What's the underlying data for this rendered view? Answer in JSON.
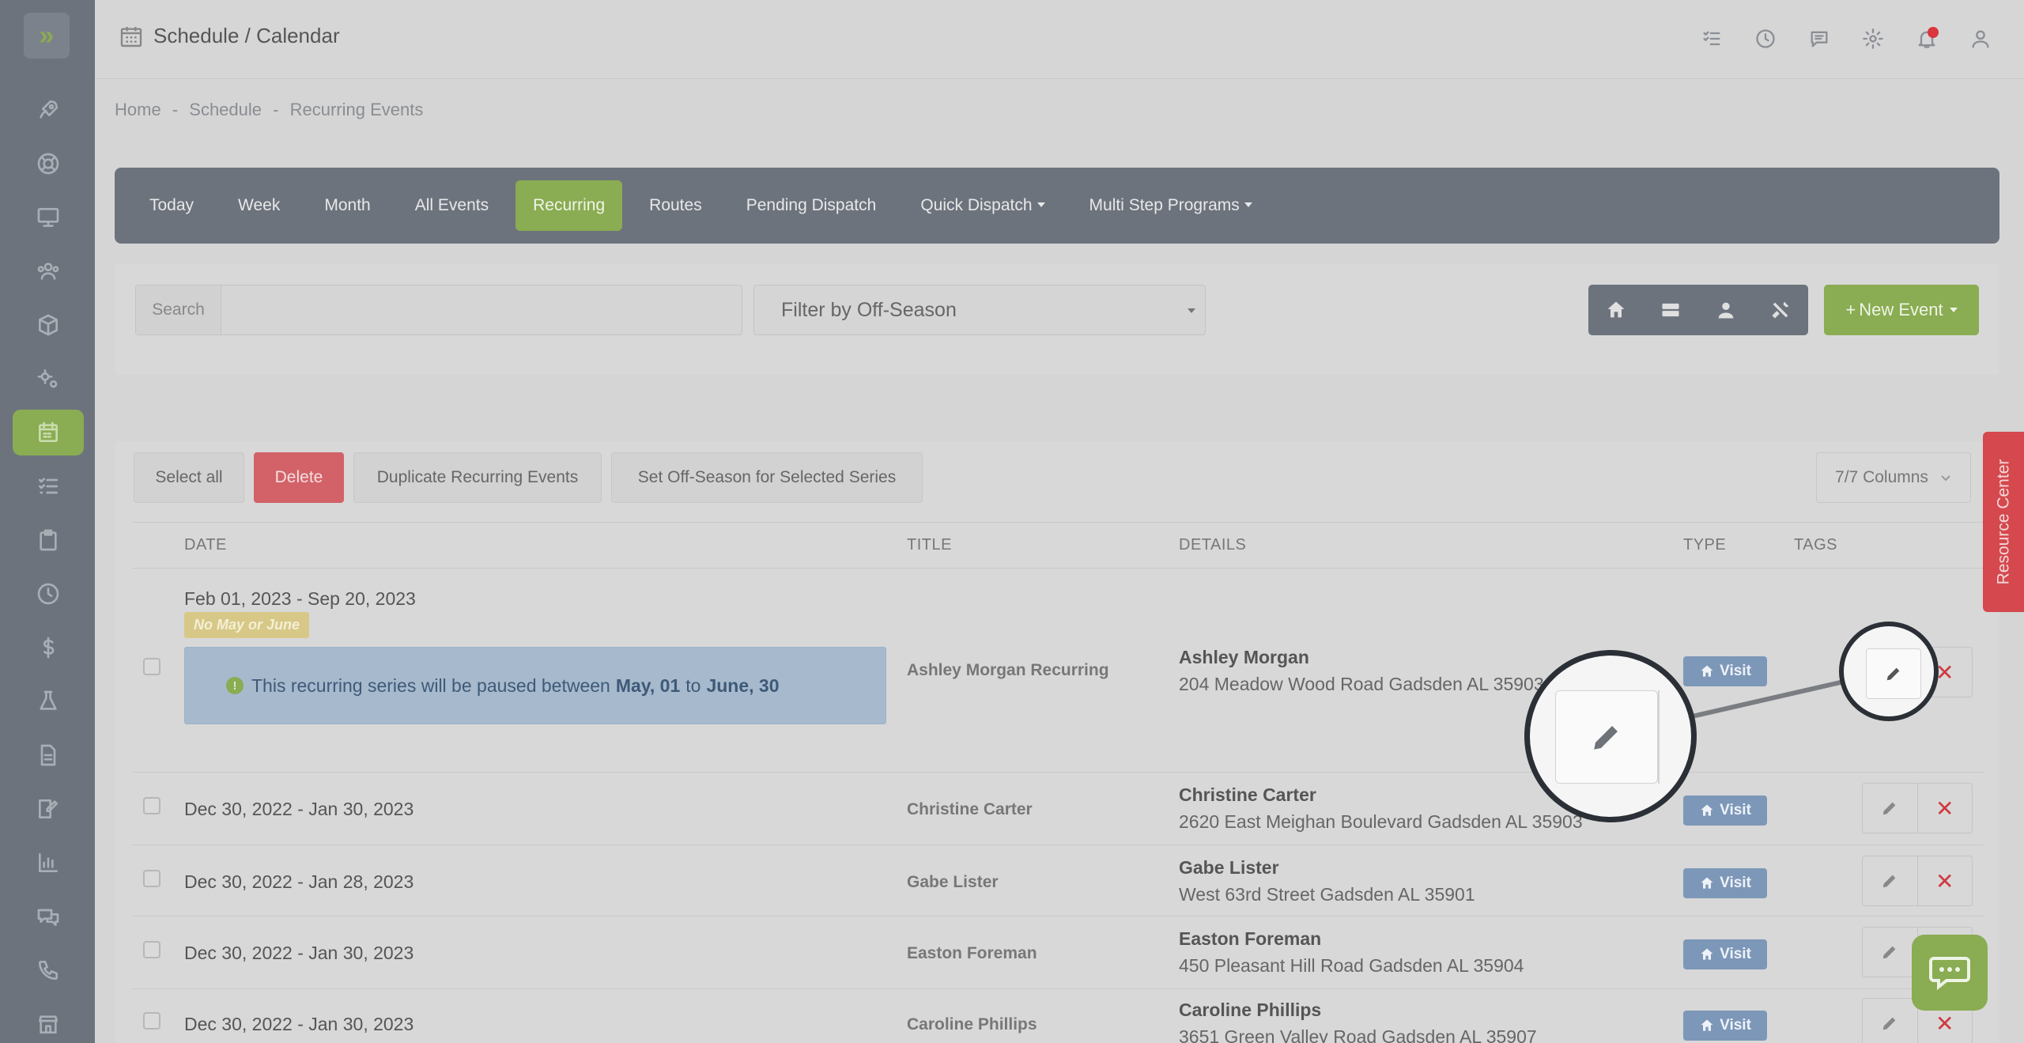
{
  "topbar": {
    "title": "Schedule / Calendar"
  },
  "breadcrumb": {
    "home": "Home",
    "schedule": "Schedule",
    "current": "Recurring Events",
    "sep": "-"
  },
  "tabs": [
    {
      "label": "Today"
    },
    {
      "label": "Week"
    },
    {
      "label": "Month"
    },
    {
      "label": "All Events"
    },
    {
      "label": "Recurring"
    },
    {
      "label": "Routes"
    },
    {
      "label": "Pending Dispatch"
    },
    {
      "label": "Quick Dispatch"
    },
    {
      "label": "Multi Step Programs"
    }
  ],
  "filters": {
    "search_label": "Search",
    "search_value": "",
    "offseason_selected": "Filter by Off-Season",
    "new_event_label": "New Event",
    "new_event_plus": "+"
  },
  "bulk": {
    "select_all": "Select all",
    "delete": "Delete",
    "duplicate": "Duplicate Recurring Events",
    "set_offseason": "Set Off-Season for Selected Series",
    "columns": "7/7 Columns"
  },
  "table": {
    "headers": {
      "date": "DATE",
      "title": "TITLE",
      "details": "DETAILS",
      "type": "TYPE",
      "tags": "TAGS"
    },
    "rows": [
      {
        "date": "Feb 01, 2023 - Sep 20, 2023",
        "badge": "No May or June",
        "title": "Ashley Morgan Recurring",
        "name": "Ashley Morgan",
        "address": "204 Meadow Wood Road Gadsden AL 35903",
        "type": "Visit"
      },
      {
        "date": "Dec 30, 2022 - Jan 30, 2023",
        "title": "Christine Carter",
        "name": "Christine Carter",
        "address": "2620 East Meighan Boulevard Gadsden AL 35903",
        "type": "Visit"
      },
      {
        "date": "Dec 30, 2022 - Jan 28, 2023",
        "title": "Gabe Lister",
        "name": "Gabe Lister",
        "address": "West 63rd Street Gadsden AL 35901",
        "type": "Visit"
      },
      {
        "date": "Dec 30, 2022 - Jan 30, 2023",
        "title": "Easton Foreman",
        "name": "Easton Foreman",
        "address": "450 Pleasant Hill Road Gadsden AL 35904",
        "type": "Visit"
      },
      {
        "date": "Dec 30, 2022 - Jan 30, 2023",
        "title": "Caroline Phillips",
        "name": "Caroline Phillips",
        "address": "3651 Green Valley Road Gadsden AL 35907",
        "type": "Visit"
      }
    ],
    "notice": {
      "prefix": "This recurring series will be paused between",
      "start": "May, 01",
      "mid": "to",
      "end": "June, 30"
    },
    "delete_glyph": "✕"
  },
  "resource_center": "Resource Center",
  "colors": {
    "accent": "#8aac52",
    "danger": "#d26267",
    "sidebar": "#6c737d",
    "visit": "#7c97b8"
  }
}
